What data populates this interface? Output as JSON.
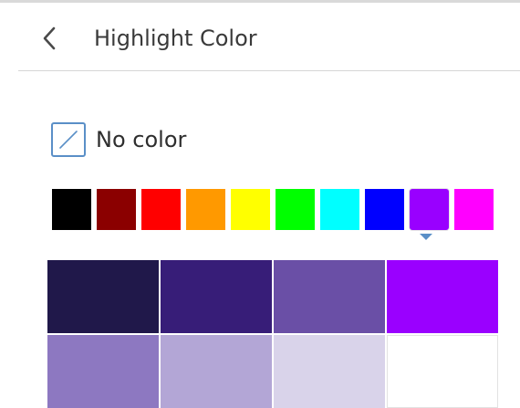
{
  "header": {
    "title": "Highlight Color",
    "back_icon": "chevron-left-icon"
  },
  "no_color": {
    "label": "No color",
    "icon": "no-color-slash-icon",
    "border_color": "#5a8fc7"
  },
  "palette": {
    "selected_index": 8,
    "selection_indicator_color": "#5a8fc7",
    "colors": [
      "#000000",
      "#8b0000",
      "#ff0000",
      "#ff9900",
      "#ffff00",
      "#00ff00",
      "#00ffff",
      "#0000ff",
      "#9900ff",
      "#ff00ff"
    ]
  },
  "shades": {
    "base_color": "#9900ff",
    "colors": [
      "#20184a",
      "#371d78",
      "#6a4fa6",
      "#9a00ff",
      "#8d78c1",
      "#b3a6d6",
      "#d9d3ea",
      "#ffffff"
    ]
  }
}
